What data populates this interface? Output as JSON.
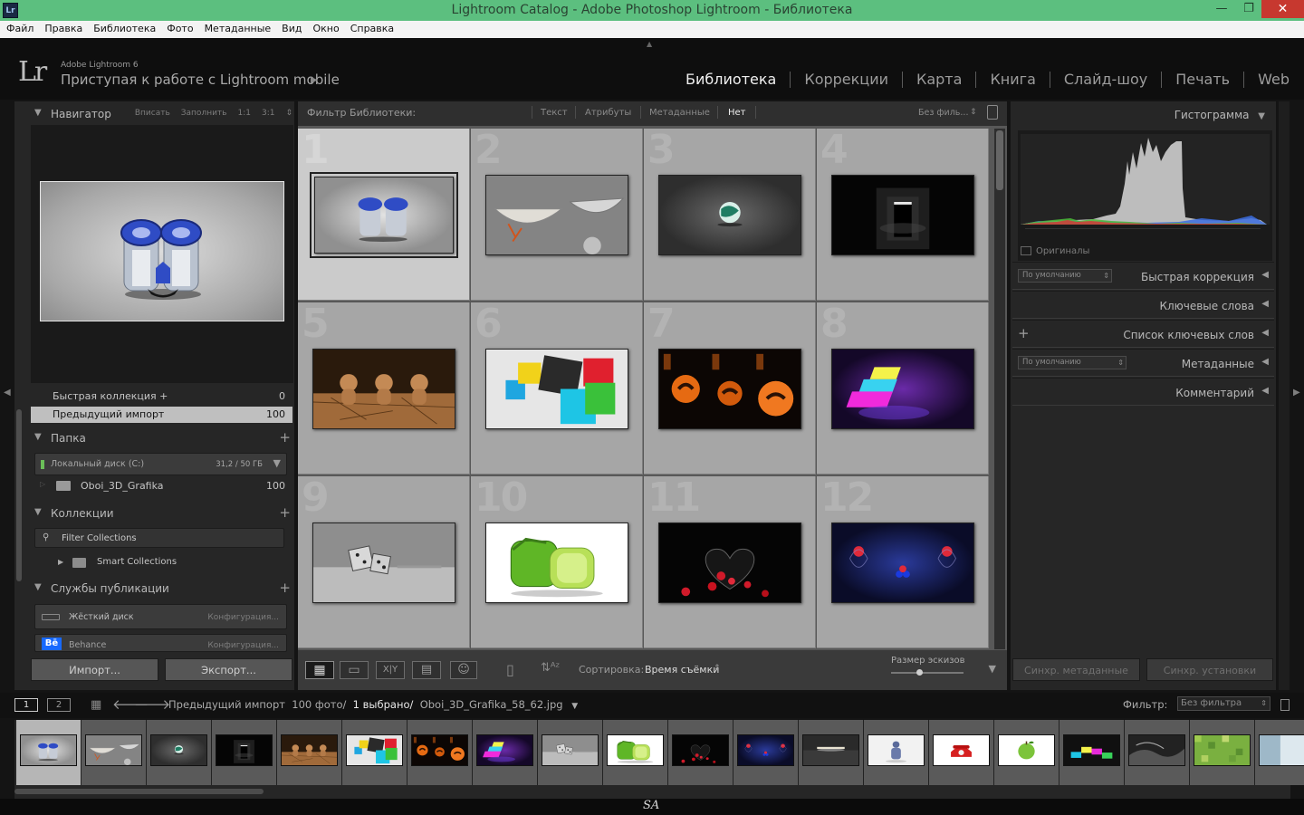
{
  "window": {
    "title": "Lightroom Catalog - Adobe Photoshop Lightroom - Библиотека",
    "app_icon": "Lr",
    "minimize": "—",
    "maximize": "❐",
    "close": "✕"
  },
  "menu": [
    "Файл",
    "Правка",
    "Библиотека",
    "Фото",
    "Метаданные",
    "Вид",
    "Окно",
    "Справка"
  ],
  "identity": {
    "logo": "Lr",
    "product": "Adobe Lightroom 6",
    "tagline": "Приступая к работе с Lightroom mobile",
    "modules": [
      "Библиотека",
      "Коррекции",
      "Карта",
      "Книга",
      "Слайд-шоу",
      "Печать",
      "Web"
    ],
    "active_module": "Библиотека"
  },
  "navigator": {
    "title": "Навигатор",
    "zoom_options": [
      "Вписать",
      "Заполнить",
      "1:1",
      "3:1"
    ]
  },
  "catalog": {
    "rows": [
      {
        "label": "Быстрая коллекция +",
        "count": "0"
      },
      {
        "label": "Предыдущий импорт",
        "count": "100"
      }
    ]
  },
  "folders": {
    "title": "Папка",
    "volume": {
      "name": "Локальный диск (C:)",
      "space": "31,2 / 50 ГБ"
    },
    "items": [
      {
        "name": "Oboi_3D_Grafika",
        "count": "100"
      }
    ]
  },
  "collections": {
    "title": "Коллекции",
    "filter": "Filter Collections",
    "smart": "Smart Collections"
  },
  "publish": {
    "title": "Службы публикации",
    "services": [
      {
        "name": "Жёсткий диск",
        "action": "Конфигурация..."
      },
      {
        "name": "Behance",
        "action": "Конфигурация..."
      }
    ]
  },
  "left_buttons": {
    "import": "Импорт...",
    "export": "Экспорт..."
  },
  "filter_bar": {
    "title": "Фильтр Библиотеки:",
    "options": [
      "Текст",
      "Атрибуты",
      "Метаданные",
      "Нет"
    ],
    "active": "Нет",
    "preset": "Без филь..."
  },
  "grid": {
    "cells": [
      {
        "num": "1",
        "img": "robot"
      },
      {
        "num": "2",
        "img": "bowls"
      },
      {
        "num": "3",
        "img": "sphere"
      },
      {
        "num": "4",
        "img": "doorway"
      },
      {
        "num": "5",
        "img": "bears"
      },
      {
        "num": "6",
        "img": "cubes"
      },
      {
        "num": "7",
        "img": "pumpkins"
      },
      {
        "num": "8",
        "img": "neon"
      },
      {
        "num": "9",
        "img": "dice"
      },
      {
        "num": "10",
        "img": "lime"
      },
      {
        "num": "11",
        "img": "hearts"
      },
      {
        "num": "12",
        "img": "bubbles"
      }
    ],
    "selected": 0
  },
  "toolbar": {
    "sort_label": "Сортировка:",
    "sort_value": "Время съёмки",
    "thumb_size": "Размер эскизов",
    "xy": "X|Y"
  },
  "right_panel": {
    "histogram": "Гистограмма",
    "originals": "Оригиналы",
    "quick_develop": {
      "label": "Быстрая коррекция",
      "preset": "По умолчанию"
    },
    "keywording": "Ключевые слова",
    "keyword_list": "Список ключевых слов",
    "metadata": {
      "label": "Метаданные",
      "preset": "По умолчанию"
    },
    "comments": "Комментарий",
    "sync_metadata": "Синхр. метаданные",
    "sync_settings": "Синхр. установки"
  },
  "filmstrip_bar": {
    "pages": [
      "1",
      "2"
    ],
    "source": "Предыдущий импорт",
    "count": "100 фото/",
    "selected": "1 выбрано/",
    "file": "Oboi_3D_Grafika_58_62.jpg",
    "filter_label": "Фильтр:",
    "filter_value": "Без фильтра"
  },
  "filmstrip": [
    "robot",
    "bowls",
    "sphere",
    "doorway",
    "bears",
    "cubes",
    "pumpkins",
    "neon",
    "dice",
    "lime",
    "hearts",
    "bubbles",
    "lamp",
    "figure",
    "phone",
    "apple",
    "blocks",
    "water",
    "pixels",
    "blank"
  ],
  "signature": "SA",
  "colors": {
    "accent_titlebar": "#5cbf7f",
    "panel": "#262626",
    "grid_cell": "#a6a6a6",
    "grid_selected": "#cbcbcb"
  }
}
